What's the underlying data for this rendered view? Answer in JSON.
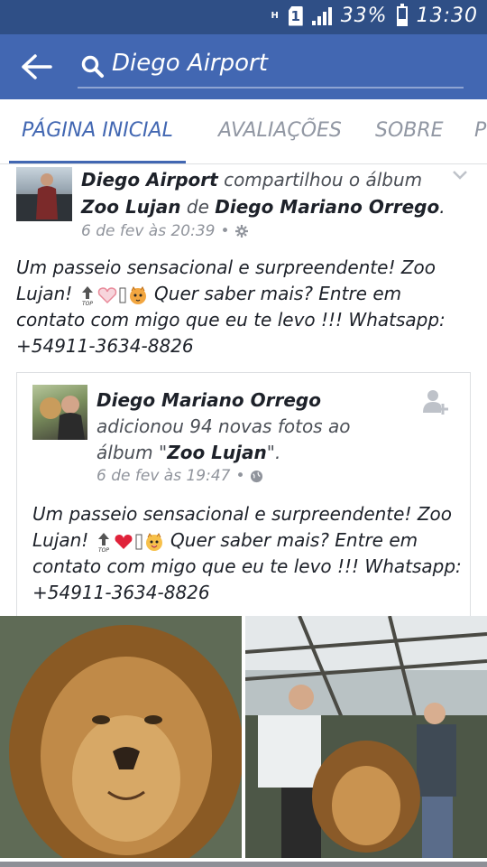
{
  "status_bar": {
    "network": "H",
    "sim": "1",
    "battery_percent": "33%",
    "battery_level": 0.33,
    "time": "13:30"
  },
  "header": {
    "search_text": "Diego Airport",
    "back_icon": "arrow-left-icon",
    "search_icon": "search-icon"
  },
  "tabs": [
    {
      "label": "PÁGINA INICIAL",
      "active": true
    },
    {
      "label": "AVALIAÇÕES",
      "active": false
    },
    {
      "label": "SOBRE",
      "active": false
    },
    {
      "label": "P",
      "active": false
    }
  ],
  "post": {
    "author": "Diego Airport",
    "action": "compartilhou o álbum",
    "album": "Zoo Lujan",
    "preposition": "de",
    "album_owner": "Diego Mariano Orrego",
    "period": ".",
    "timestamp": "6 de fev às 20:39",
    "separator": "•",
    "body_part1": "Um passeio sensacional e surpreendente! Zoo Lujan!",
    "body_part2": "Quer saber mais? Entre em contato com migo que eu te levo !!! Whatsapp: +54911-3634-8826"
  },
  "shared": {
    "author": "Diego Mariano Orrego",
    "action_prefix": "adicionou 94 novas fotos ao álbum \"",
    "album": "Zoo Lujan",
    "action_suffix": "\".",
    "timestamp": "6 de fev às 19:47",
    "separator": "•",
    "body_part1": "Um passeio sensacional e surpreendente! Zoo Lujan!",
    "body_part2": "Quer saber mais? Entre em contato com migo que eu te levo !!! Whatsapp: +54911-3634-8826"
  },
  "colors": {
    "brand": "#4267b2",
    "status_bar": "#2f4f86",
    "muted_text": "#90949c"
  }
}
